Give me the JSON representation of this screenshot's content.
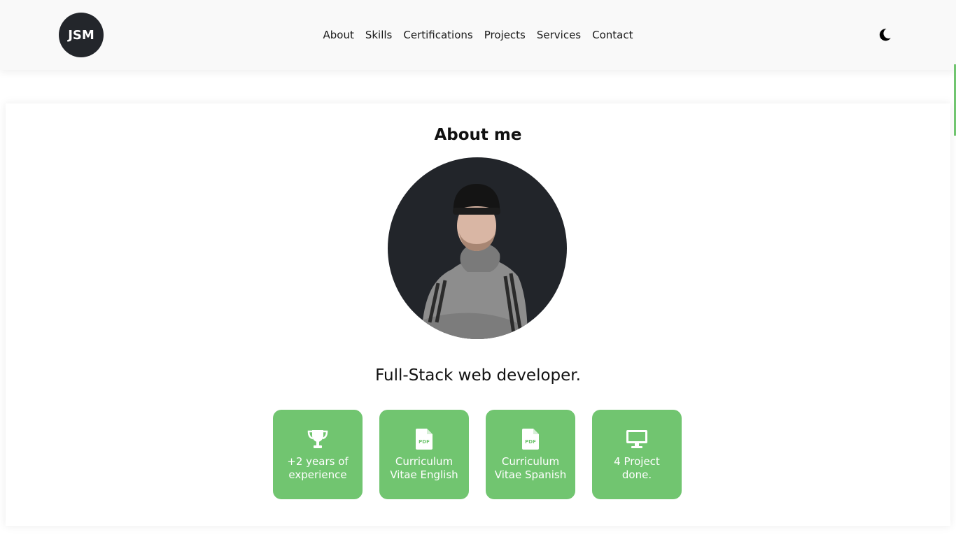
{
  "header": {
    "logo_text": "JSM",
    "nav": [
      {
        "label": "About"
      },
      {
        "label": "Skills"
      },
      {
        "label": "Certifications"
      },
      {
        "label": "Projects"
      },
      {
        "label": "Services"
      },
      {
        "label": "Contact"
      }
    ],
    "theme_icon": "moon-icon"
  },
  "about": {
    "title": "About me",
    "role": "Full-Stack web developer.",
    "cards": [
      {
        "icon": "trophy-icon",
        "label": "+2 years of experience"
      },
      {
        "icon": "pdf-file-icon",
        "label": "Curriculum Vitae English"
      },
      {
        "icon": "pdf-file-icon",
        "label": "Curriculum Vitae Spanish"
      },
      {
        "icon": "monitor-icon",
        "label": "4 Project done."
      }
    ]
  },
  "colors": {
    "accent": "#71c570",
    "dark": "#23262b",
    "header_bg": "#f9f9f9"
  }
}
